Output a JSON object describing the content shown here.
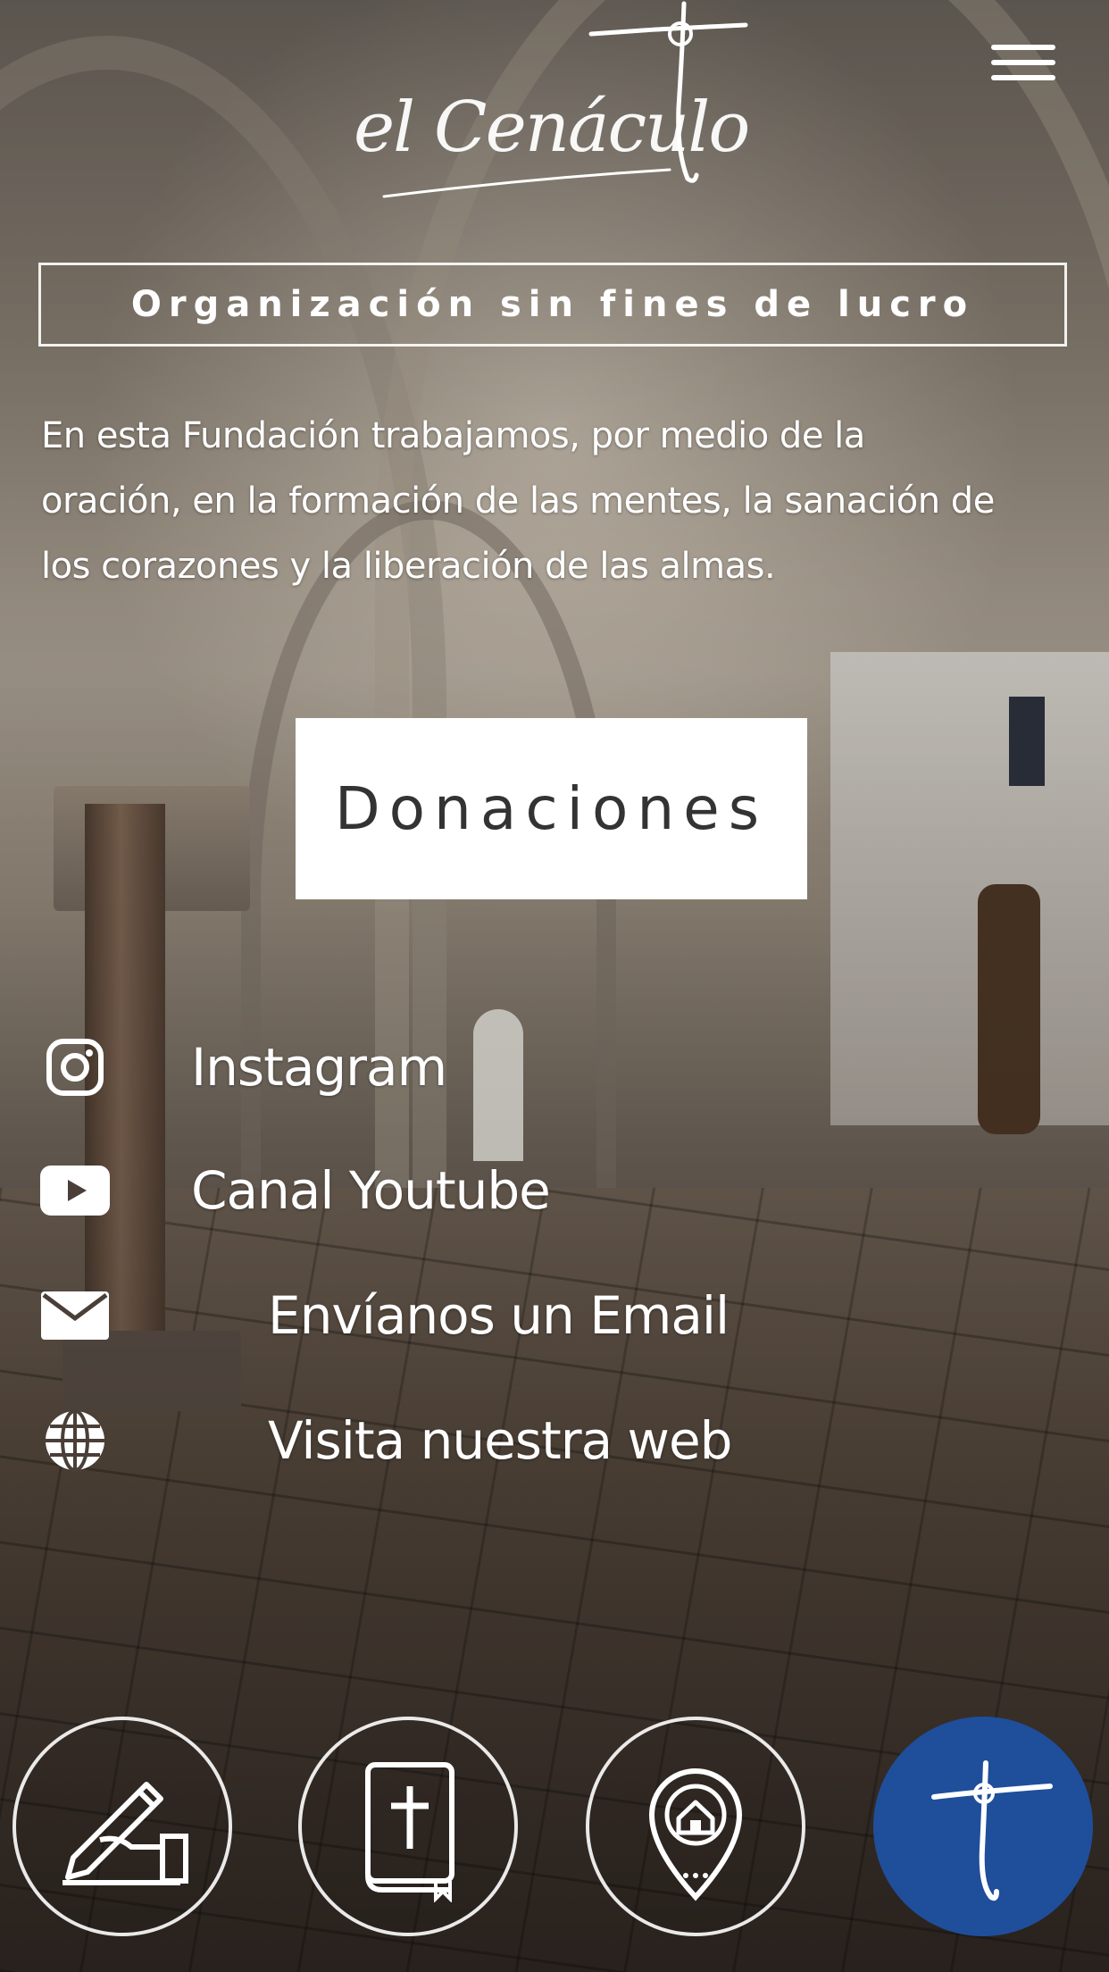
{
  "header": {
    "logo_text": "el Cenáculo",
    "menu_icon": "hamburger-menu-icon"
  },
  "tagline": "Organización sin fines de lucro",
  "intro": {
    "line1": "En esta Fundación trabajamos, por medio de la",
    "line2": "oración, en la formación de las mentes, la sanación de",
    "line3": "los corazones y la liberación de las almas."
  },
  "donate_label": "Donaciones",
  "links": [
    {
      "label": "Instagram",
      "icon": "instagram-icon"
    },
    {
      "label": "Canal Youtube",
      "icon": "youtube-icon"
    },
    {
      "label": "Envíanos un Email",
      "icon": "mail-icon"
    },
    {
      "label": "Visita nuestra web",
      "icon": "globe-icon"
    }
  ],
  "bottom_nav": [
    {
      "icon": "prayer-request-icon"
    },
    {
      "icon": "bible-icon"
    },
    {
      "icon": "location-home-icon"
    },
    {
      "icon": "cross-logo-icon",
      "color": "#1f4e9b"
    }
  ],
  "colors": {
    "button_bg": "#ffffff",
    "button_text": "#333333",
    "accent_blue": "#1f4e9b",
    "text": "#ffffff"
  }
}
